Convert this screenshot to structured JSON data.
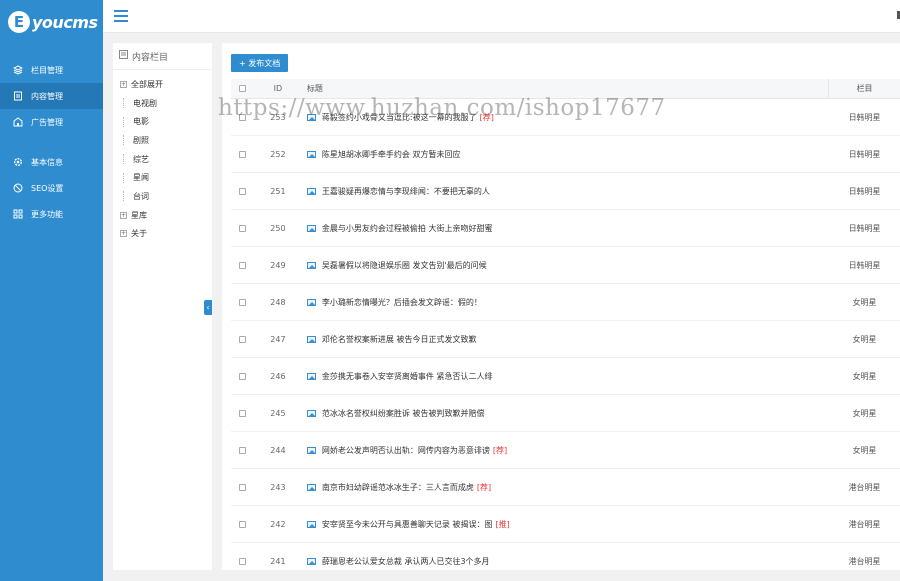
{
  "logo": {
    "mark": "E",
    "text": "youcms"
  },
  "sidebar": {
    "items": [
      {
        "label": "栏目管理",
        "icon": "layers-icon"
      },
      {
        "label": "内容管理",
        "icon": "document-icon",
        "active": true
      },
      {
        "label": "广告管理",
        "icon": "building-icon"
      },
      {
        "label": "基本信息",
        "icon": "gear-icon"
      },
      {
        "label": "SEO设置",
        "icon": "compass-icon"
      },
      {
        "label": "更多功能",
        "icon": "grid-icon"
      }
    ]
  },
  "tree": {
    "title": "内容栏目",
    "nodes": [
      {
        "label": "全部展开",
        "type": "root"
      },
      {
        "label": "电视剧",
        "type": "child"
      },
      {
        "label": "电影",
        "type": "child"
      },
      {
        "label": "剧照",
        "type": "child"
      },
      {
        "label": "综艺",
        "type": "child"
      },
      {
        "label": "星闻",
        "type": "child"
      },
      {
        "label": "台词",
        "type": "child"
      },
      {
        "label": "星库",
        "type": "root"
      },
      {
        "label": "关于",
        "type": "root"
      }
    ]
  },
  "toolbar": {
    "publish_label": "+ 发布文档"
  },
  "table": {
    "headers": {
      "id": "ID",
      "title": "标题",
      "column": "栏目"
    },
    "rows": [
      {
        "id": "253",
        "title": "蒋毅签约小戏骨又当逗比:被这一幕的我服了",
        "flag": "[荐]",
        "column": "日韩明星"
      },
      {
        "id": "252",
        "title": "陈星旭胡冰卿手牵手约会 双方暂未回应",
        "flag": "",
        "column": "日韩明星"
      },
      {
        "id": "251",
        "title": "王嘉骏疑再爆恋情与李现绯闻：不要把无辜的人",
        "flag": "",
        "column": "日韩明星"
      },
      {
        "id": "250",
        "title": "金晨与小男友约会过程被偷拍 大街上亲吻好甜蜜",
        "flag": "",
        "column": "日韩明星"
      },
      {
        "id": "249",
        "title": "吴磊暑假以将隐退娱乐圈 发文告别'最后的问候",
        "flag": "",
        "column": "日韩明星"
      },
      {
        "id": "248",
        "title": "李小璐新恋情曝光？后插会发文辟谣：假的！",
        "flag": "",
        "column": "女明星"
      },
      {
        "id": "247",
        "title": "邓伦名誉权案新进展 被告今日正式发文致歉",
        "flag": "",
        "column": "女明星"
      },
      {
        "id": "246",
        "title": "金莎携无事卷入安宰贤离婚事件 紧急否认二人绯",
        "flag": "",
        "column": "女明星"
      },
      {
        "id": "245",
        "title": "范冰冰名誉权纠纷案胜诉 被告被判致歉并赔偿",
        "flag": "",
        "column": "女明星"
      },
      {
        "id": "244",
        "title": "网娇老公发声明否认出轨：网传内容为恶意诽谤",
        "flag": "[荐]",
        "column": "女明星"
      },
      {
        "id": "243",
        "title": "南京市妇幼辟谣范冰冰生子：三人言而成虎",
        "flag": "[荐]",
        "column": "港台明星"
      },
      {
        "id": "242",
        "title": "安宰贤至今未公开与具惠善聊天记录 被揭误：图",
        "flag": "[推]",
        "column": "港台明星"
      },
      {
        "id": "241",
        "title": "薛瑞恩老公认爱女总裁 承认两人已交往3个多月",
        "flag": "",
        "column": "港台明星"
      }
    ]
  },
  "watermark": "https://www.huzhan.com/ishop17677",
  "colors": {
    "accent": "#2e8ccf",
    "accent_dark": "#2478b5",
    "flag": "#e33333"
  }
}
